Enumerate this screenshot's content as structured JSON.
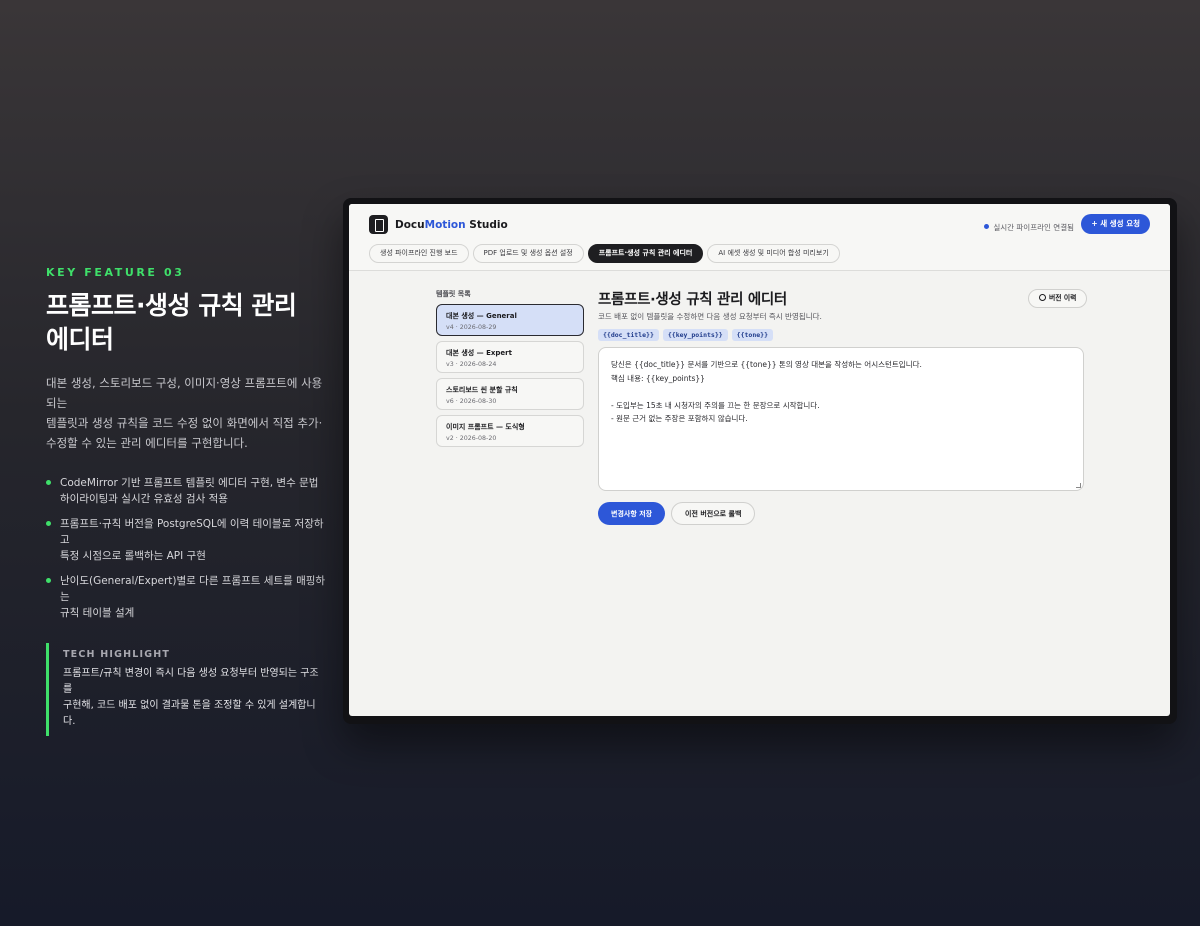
{
  "feature": {
    "kicker": "KEY FEATURE 03",
    "headline_line1": "프롬프트·생성 규칙 관리",
    "headline_line2": "에디터",
    "desc_line1": "대본 생성, 스토리보드 구성, 이미지·영상 프롬프트에 사용되는",
    "desc_line2": "템플릿과 생성 규칙을 코드 수정 없이 화면에서 직접 추가·",
    "desc_line3": "수정할 수 있는 관리 에디터를 구현합니다.",
    "bullets": [
      {
        "line1": "CodeMirror 기반 프롬프트 템플릿 에디터 구현, 변수 문법",
        "line2": "하이라이팅과 실시간 유효성 검사 적용"
      },
      {
        "line1": "프롬프트·규칙 버전을 PostgreSQL에 이력 테이블로 저장하고",
        "line2": "특정 시점으로 롤백하는 API 구현"
      },
      {
        "line1": "난이도(General/Expert)별로 다른 프롬프트 세트를 매핑하는",
        "line2": "규칙 테이블 설계"
      }
    ],
    "tech_title": "TECH HIGHLIGHT",
    "tech_line1": "프롬프트/규칙 변경이 즉시 다음 생성 요청부터 반영되는 구조를",
    "tech_line2": "구현해, 코드 배포 없이 결과물 톤을 조정할 수 있게 설계합니다."
  },
  "app": {
    "brand_part1": "Docu",
    "brand_part2": "Motion",
    "brand_part3": " Studio",
    "status": "실시간 파이프라인 연결됨",
    "new_button": "+ 새 생성 요청",
    "tabs": [
      "생성 파이프라인 진행 보드",
      "PDF 업로드 및 생성 옵션 설정",
      "프롬프트·생성 규칙 관리 에디터",
      "AI 에셋 생성 및 미디어 합성 미리보기"
    ],
    "active_tab_index": 2,
    "list_title": "템플릿 목록",
    "templates": [
      {
        "name": "대본 생성 — General",
        "meta": "v4 · 2026-08-29"
      },
      {
        "name": "대본 생성 — Expert",
        "meta": "v3 · 2026-08-24"
      },
      {
        "name": "스토리보드 씬 분할 규칙",
        "meta": "v6 · 2026-08-30"
      },
      {
        "name": "이미지 프롬프트 — 도식형",
        "meta": "v2 · 2026-08-20"
      }
    ],
    "selected_template_index": 0,
    "editor_title": "프롬프트·생성 규칙 관리 에디터",
    "editor_subtitle": "코드 배포 없이 템플릿을 수정하면 다음 생성 요청부터 즉시 반영됩니다.",
    "history_button": "버전 이력",
    "variables": [
      "{{doc_title}}",
      "{{key_points}}",
      "{{tone}}"
    ],
    "editor_lines": [
      "당신은 {{doc_title}} 문서를 기반으로 {{tone}} 톤의 영상 대본을 작성하는 어시스턴트입니다.",
      "핵심 내용: {{key_points}}",
      "",
      "- 도입부는 15초 내 시청자의 주의를 끄는 한 문장으로 시작합니다.",
      "- 원문 근거 없는 주장은 포함하지 않습니다."
    ],
    "save_button": "변경사항 저장",
    "rollback_button": "이전 버전으로 롤백"
  },
  "colors": {
    "accent_green": "#3fe06a",
    "primary_blue": "#2d57d8",
    "selected_bg": "#d5dff7"
  }
}
